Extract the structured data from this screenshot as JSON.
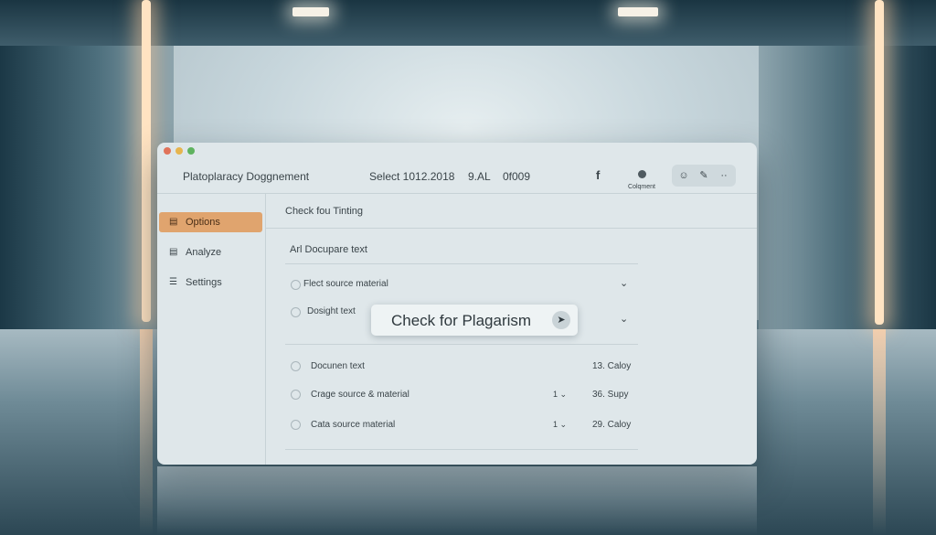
{
  "window": {
    "title": "Platoplaracy Doggnement",
    "header_select": "Select 1012.2018",
    "header_time": "9.AL",
    "header_code": "0f009",
    "colors": {
      "traffic_red": "#e0735a",
      "traffic_yellow": "#e6b54f",
      "traffic_green": "#5fb35f",
      "active_nav": "#e0a46e"
    }
  },
  "toolbar": {
    "facebook_icon": "f",
    "comment_label": "Colqment",
    "icons": [
      "smiley-icon",
      "pencil-icon",
      "more-icon"
    ]
  },
  "sidebar": {
    "items": [
      {
        "label": "Options",
        "icon": "document-icon",
        "active": true
      },
      {
        "label": "Analyze",
        "icon": "document-icon",
        "active": false
      },
      {
        "label": "Settings",
        "icon": "list-icon",
        "active": false
      }
    ]
  },
  "main": {
    "header": "Check fou Tinting",
    "section_label": "Arl Docupare text",
    "options": [
      {
        "label": "Flect source material"
      },
      {
        "label": "Dosight text"
      }
    ],
    "rows": [
      {
        "label": "Docunen text",
        "value": "13. Caloy"
      },
      {
        "label": "Crage source & material",
        "value": "36. Supy",
        "sort": "1"
      },
      {
        "label": "Cata source material",
        "value": "29. Caloy",
        "sort": "1"
      }
    ]
  },
  "check_button": {
    "label": "Check for Plagarism"
  }
}
